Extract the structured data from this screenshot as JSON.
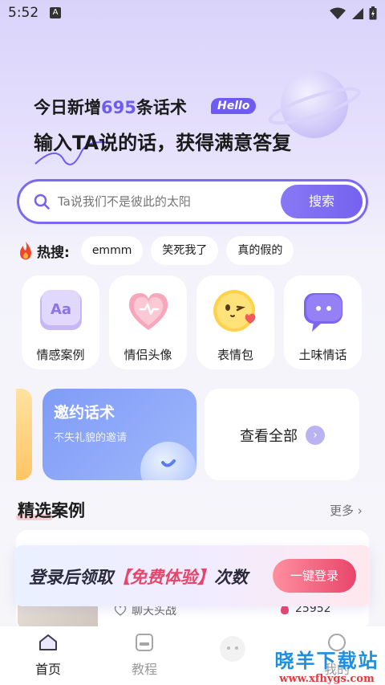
{
  "status_bar": {
    "time": "5:52",
    "badge": "A"
  },
  "hero": {
    "line1_prefix": "今日新增",
    "line1_count": "695",
    "line1_suffix": "条话术",
    "hello_badge": "Hello",
    "line2": "输入TA说的话，获得满意答复"
  },
  "search": {
    "placeholder": "Ta说我们不是彼此的太阳",
    "button_label": "搜索"
  },
  "hot": {
    "label": "热搜:",
    "chips": [
      "emmm",
      "笑死我了",
      "真的假的"
    ]
  },
  "categories": [
    {
      "label": "情感案例",
      "icon": "text-aa-icon"
    },
    {
      "label": "情侣头像",
      "icon": "heart-icon"
    },
    {
      "label": "表情包",
      "icon": "wink-emoji-icon"
    },
    {
      "label": "土味情话",
      "icon": "chat-bubble-icon"
    }
  ],
  "promo": {
    "invite_title": "邀约话术",
    "invite_subtitle": "不失礼貌的邀请",
    "view_all": "查看全部"
  },
  "featured": {
    "title": "精选案例",
    "more": "更多",
    "card_meta": "聊天头战",
    "card_count": "25952"
  },
  "login_banner": {
    "text_prefix": "登录后领取",
    "text_highlight": "【免费体验】",
    "text_suffix": "次数",
    "button_label": "一键登录"
  },
  "tabbar": {
    "home": "首页",
    "tutorial": "教程",
    "mine": "我的"
  },
  "watermark": {
    "cn": "晓羊下载站",
    "url": "www.xfhygs.com"
  },
  "colors": {
    "accent": "#7562ef",
    "highlight": "#e8456a"
  }
}
